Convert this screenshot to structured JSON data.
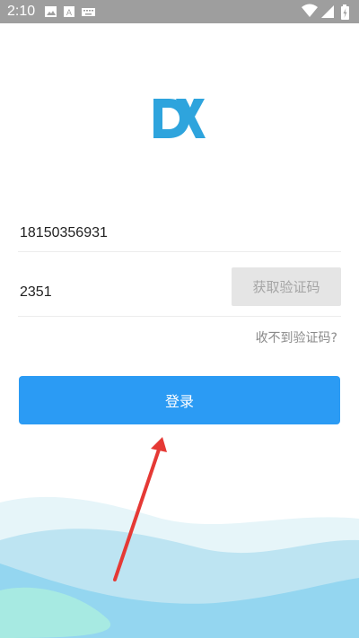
{
  "status_bar": {
    "time": "2:10",
    "left_icons": [
      "image-icon",
      "font-a-icon",
      "keyboard-icon"
    ],
    "right_icons": [
      "wifi-icon",
      "signal-icon",
      "battery-charging-icon"
    ]
  },
  "logo": {
    "name": "dx-logo-icon",
    "color": "#2ea4dd"
  },
  "form": {
    "phone_value": "18150356931",
    "code_value": "2351",
    "get_code_label": "获取验证码",
    "no_code_label": "收不到验证码?",
    "login_label": "登录"
  },
  "colors": {
    "accent": "#2b9bf4",
    "disabled_button_bg": "#e5e5e5",
    "annotation_arrow": "#e53935"
  }
}
